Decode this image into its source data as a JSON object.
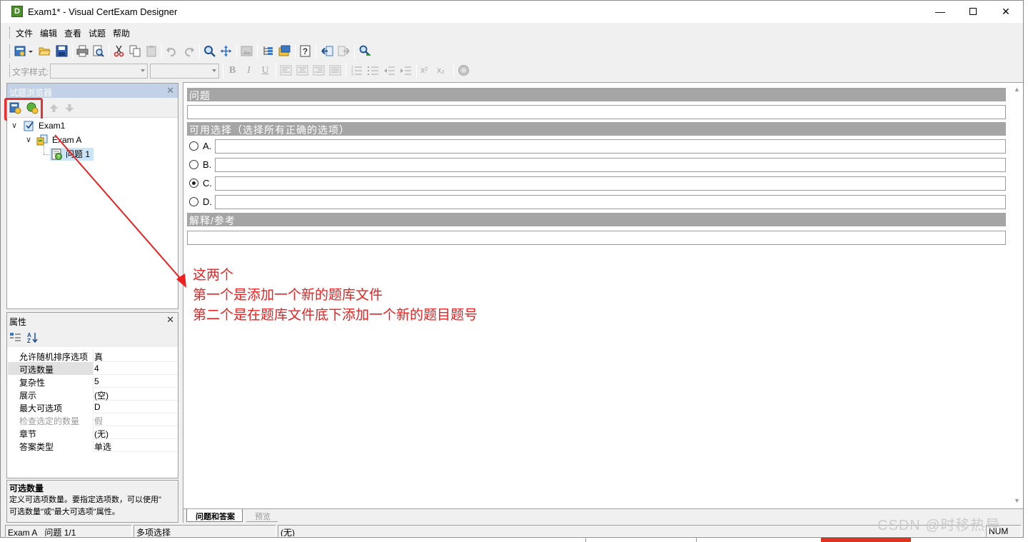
{
  "window": {
    "title": "Exam1* - Visual CertExam Designer",
    "app_icon_letter": "D"
  },
  "menu": [
    "文件",
    "编辑",
    "查看",
    "试题",
    "帮助"
  ],
  "format_toolbar": {
    "style_label": "文字样式:",
    "bold": "B",
    "italic": "I",
    "underline": "U",
    "superscript": "x²",
    "subscript": "x₂"
  },
  "explorer": {
    "title": "试题浏览器",
    "tree": [
      {
        "label": "Exam1",
        "level": 0,
        "icon": "exam-icon",
        "expanded": true
      },
      {
        "label": "Exam A",
        "level": 1,
        "icon": "section-icon",
        "expanded": true
      },
      {
        "label": "问题 1",
        "level": 2,
        "icon": "question-icon",
        "selected": true
      }
    ]
  },
  "properties": {
    "title": "属性",
    "rows": [
      {
        "key": "允许随机排序选项",
        "value": "真"
      },
      {
        "key": "可选数量",
        "value": "4",
        "selected": true
      },
      {
        "key": "复杂性",
        "value": "5"
      },
      {
        "key": "展示",
        "value": "(空)"
      },
      {
        "key": "最大可选项",
        "value": "D"
      },
      {
        "key": "检查选定的数量",
        "value": "假",
        "disabled": true
      },
      {
        "key": "章节",
        "value": "(无)"
      },
      {
        "key": "答案类型",
        "value": "单选"
      }
    ],
    "help_title": "可选数量",
    "help_text_1": "定义可选项数量。要指定选项数，可以使用\"",
    "help_text_2": "可选数量\"或\"最大可选项\"属性。"
  },
  "editor": {
    "question_header": "问题",
    "choices_header": "可用选择（选择所有正确的选项）",
    "options": [
      {
        "label": "A.",
        "checked": false
      },
      {
        "label": "B.",
        "checked": false
      },
      {
        "label": "C.",
        "checked": true
      },
      {
        "label": "D.",
        "checked": false
      }
    ],
    "explanation_header": "解释/参考",
    "tabs": [
      "问题和答案",
      "预览"
    ]
  },
  "annotation": {
    "color": "#ee1f1f",
    "lines": [
      "这两个",
      "第一个是添加一个新的题库文件",
      "第二个是在题库文件底下添加一个新的题目题号"
    ]
  },
  "status": {
    "section": "Exam A",
    "question": "问题 1/1",
    "type": "多项选择",
    "chapter": "(无)",
    "num": "NUM"
  },
  "watermark": "CSDN @时移热导"
}
